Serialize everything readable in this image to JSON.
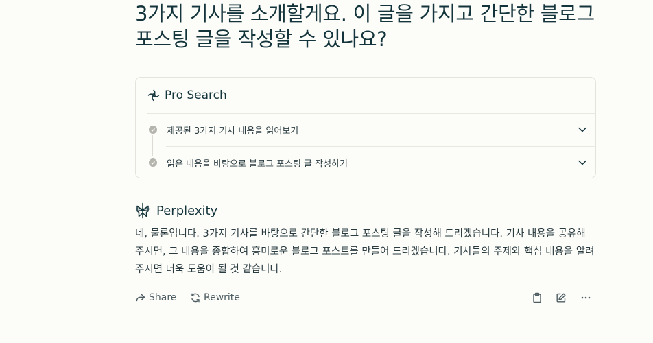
{
  "question": {
    "text": "3가지 기사를 소개할게요. 이 글을 가지고 간단한 블로그 포스팅 글을 작성할 수 있나요?"
  },
  "pro_search": {
    "title": "Pro Search",
    "steps": [
      {
        "label": "제공된 3가지 기사 내용을 읽어보기"
      },
      {
        "label": "읽은 내용을 바탕으로 블로그 포스팅 글 작성하기"
      }
    ]
  },
  "answer": {
    "source_name": "Perplexity",
    "body": "네, 물론입니다. 3가지 기사를 바탕으로 간단한 블로그 포스팅 글을 작성해 드리겠습니다. 기사 내용을 공유해 주시면, 그 내용을 종합하여 흥미로운 블로그 포스트를 만들어 드리겠습니다. 기사들의 주제와 핵심 내용을 알려주시면 더욱 도움이 될 것 같습니다."
  },
  "actions": {
    "share_label": "Share",
    "rewrite_label": "Rewrite"
  },
  "colors": {
    "background": "#fcfcf9",
    "text": "#13343b",
    "muted": "#4d5d62",
    "border": "#e4e4dc"
  }
}
